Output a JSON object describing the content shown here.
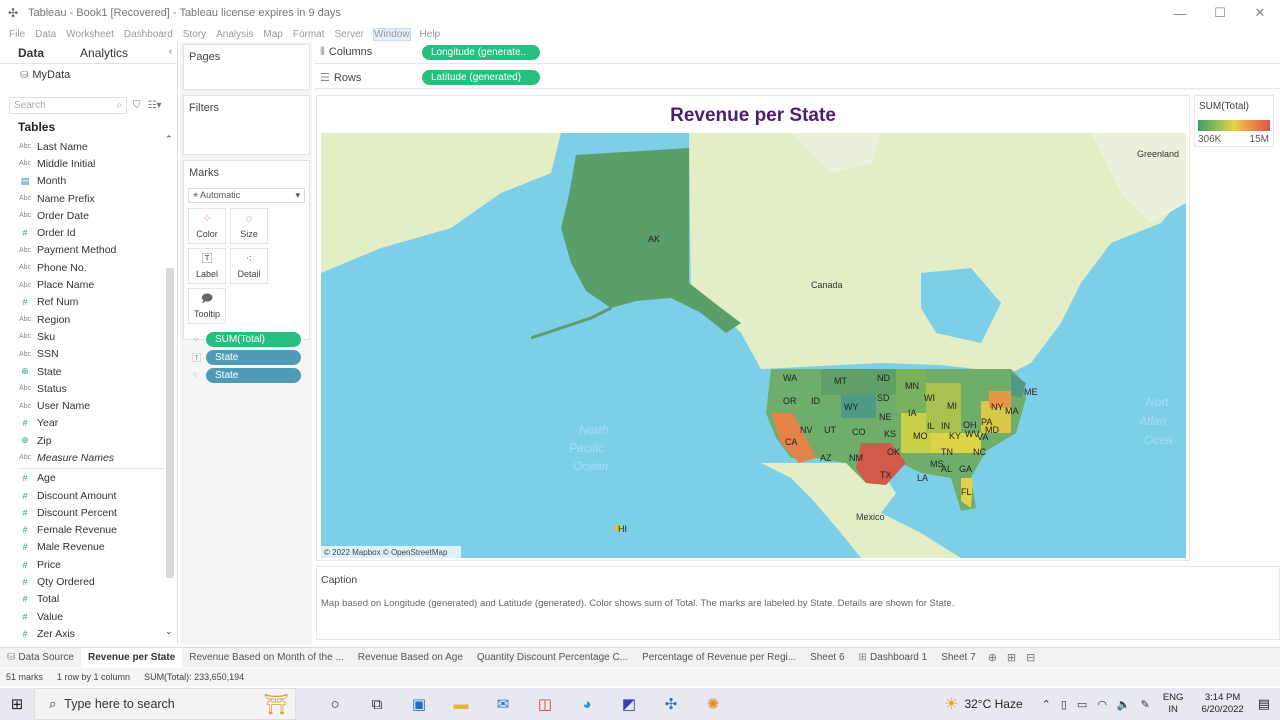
{
  "window": {
    "title": "Tableau - Book1 [Recovered] - Tableau license expires in 9 days"
  },
  "menu": [
    "File",
    "Data",
    "Worksheet",
    "Dashboard",
    "Story",
    "Analysis",
    "Map",
    "Format",
    "Server",
    "Window",
    "Help"
  ],
  "data_pane": {
    "tabs": [
      "Data",
      "Analytics"
    ],
    "datasource": "MyData",
    "search_placeholder": "Search",
    "tables_header": "Tables",
    "dimensions": [
      {
        "label": "Last Name",
        "type": "Abc"
      },
      {
        "label": "Middle Initial",
        "type": "Abc"
      },
      {
        "label": "Month",
        "type": "cal"
      },
      {
        "label": "Name Prefix",
        "type": "Abc"
      },
      {
        "label": "Order Date",
        "type": "Abc"
      },
      {
        "label": "Order Id",
        "type": "#"
      },
      {
        "label": "Payment Method",
        "type": "Abc"
      },
      {
        "label": "Phone No.",
        "type": "Abc"
      },
      {
        "label": "Place Name",
        "type": "Abc"
      },
      {
        "label": "Ref Num",
        "type": "#"
      },
      {
        "label": "Region",
        "type": "Abc"
      },
      {
        "label": "Sku",
        "type": "Abc"
      },
      {
        "label": "SSN",
        "type": "Abc"
      },
      {
        "label": "State",
        "type": "geo"
      },
      {
        "label": "Status",
        "type": "Abc"
      },
      {
        "label": "User Name",
        "type": "Abc"
      },
      {
        "label": "Year",
        "type": "#"
      },
      {
        "label": "Zip",
        "type": "geo"
      },
      {
        "label": "Measure Names",
        "type": "Abc"
      }
    ],
    "measures": [
      "Age",
      "Discount Amount",
      "Discount Percent",
      "Female Revenue",
      "Male Revenue",
      "Price",
      "Qty Ordered",
      "Total",
      "Value",
      "Zer Axis"
    ]
  },
  "cards": {
    "pages": "Pages",
    "filters": "Filters",
    "marks": "Marks",
    "marks_type": "Automatic",
    "mark_buttons": [
      "Color",
      "Size",
      "Label",
      "Detail",
      "Tooltip"
    ],
    "mark_pills": [
      "SUM(Total)",
      "State",
      "State"
    ]
  },
  "shelves": {
    "columns_label": "Columns",
    "columns_pill": "Longitude (generate..",
    "rows_label": "Rows",
    "rows_pill": "Latitude (generated)"
  },
  "view": {
    "title": "Revenue per State",
    "map_labels": {
      "greenland": "Greenland",
      "canada": "Canada",
      "mexico": "Mexico",
      "ocean1": "North",
      "ocean2": "Pacific",
      "ocean3": "Ocean",
      "atl1": "Nort",
      "atl2": "Atlan",
      "atl3": "Ocea",
      "attribution": "© 2022 Mapbox © OpenStreetMap"
    },
    "state_labels": [
      "AK",
      "WA",
      "MT",
      "ND",
      "MN",
      "OR",
      "ID",
      "SD",
      "WI",
      "MI",
      "ME",
      "WY",
      "NY",
      "IA",
      "NE",
      "MA",
      "NV",
      "UT",
      "CO",
      "KS",
      "IL",
      "IN",
      "OH",
      "PA",
      "CA",
      "MO",
      "WV",
      "MD",
      "KY",
      "VA",
      "TN",
      "NC",
      "OK",
      "AZ",
      "NM",
      "TX",
      "MS",
      "AL",
      "GA",
      "LA",
      "FL",
      "HI"
    ]
  },
  "legend": {
    "title": "SUM(Total)",
    "min": "306K",
    "max": "15M"
  },
  "caption": {
    "header": "Caption",
    "text": "Map based on Longitude (generated) and Latitude (generated).  Color shows sum of Total.  The marks are labeled by State.  Details are shown for State."
  },
  "sheet_tabs": [
    "Data Source",
    "Revenue per State",
    "Revenue Based on Month of the ...",
    "Revenue Based on Age",
    "Quantity Discount Percentage C...",
    "Percentage of Revenue per Regi...",
    "Sheet 6",
    "Dashboard 1",
    "Sheet 7"
  ],
  "status": {
    "marks": "51 marks",
    "dims": "1 row by 1 column",
    "sum": "SUM(Total): 233,650,194"
  },
  "taskbar": {
    "search_placeholder": "Type here to search",
    "weather": "32°C  Haze",
    "lang1": "ENG",
    "lang2": "IN",
    "time": "3:14 PM",
    "date": "6/20/2022"
  },
  "colors": {
    "accent_pill": "#25c07f",
    "dim_pill": "#4f9bb6",
    "title": "#4e1d6b",
    "water": "#7dcfe8",
    "land": "#e3eec6"
  }
}
